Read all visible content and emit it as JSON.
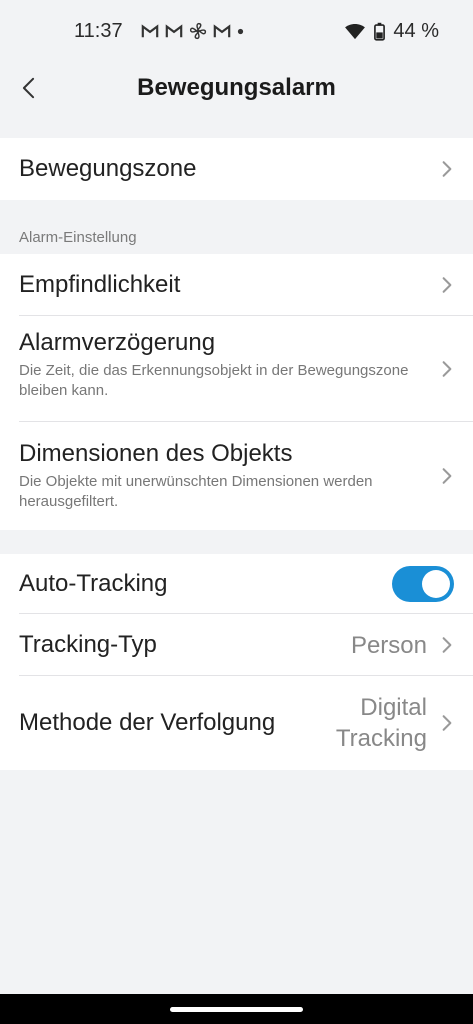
{
  "status": {
    "time": "11:37",
    "battery": "44 %",
    "notification_icons": [
      "gmail-icon",
      "gmail-icon",
      "fan-icon",
      "gmail-icon",
      "dot-icon"
    ]
  },
  "header": {
    "title": "Bewegungsalarm"
  },
  "rows": {
    "zone": {
      "label": "Bewegungszone"
    },
    "section_label": "Alarm-Einstellung",
    "sensitivity": {
      "label": "Empfindlichkeit"
    },
    "delay": {
      "label": "Alarmverzögerung",
      "sub": "Die Zeit, die das Erkennungsobjekt in der Bewegungszone bleiben kann."
    },
    "dimensions": {
      "label": "Dimensionen des Objekts",
      "sub": "Die Objekte mit unerwünschten Dimensionen werden herausgefiltert."
    },
    "auto_tracking": {
      "label": "Auto-Tracking",
      "enabled": true
    },
    "tracking_type": {
      "label": "Tracking-Typ",
      "value": "Person"
    },
    "tracking_method": {
      "label": "Methode der Verfolgung",
      "value_line1": "Digital",
      "value_line2": "Tracking"
    }
  },
  "colors": {
    "accent": "#1a8fd6",
    "background": "#f2f3f5"
  }
}
